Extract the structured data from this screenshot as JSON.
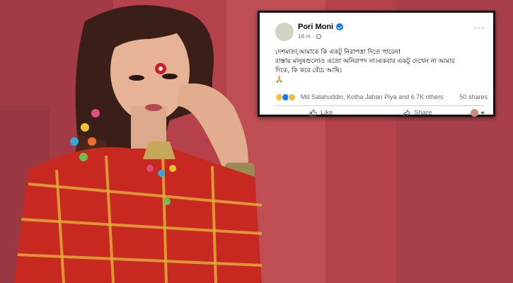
{
  "post": {
    "author": "Pori Moni",
    "time": "16 m",
    "time_separator": "·",
    "more_label": "···",
    "text_lines": [
      "দেশমাতা,আমাকে কি একটু নিরাপত্তা দিতে পারেন!",
      "রাস্তায় মানুষগুলোও এতো অনিরাপদ না।একবার একটু দেখেন না আমার",
      "দিকে, কি করে বেঁচে আছি।"
    ],
    "emoji": "🙏",
    "reactions_summary": "Md Salahuddin, Kotha Jahan Piya and 6.7K others",
    "shares": "50 shares",
    "like_label": "Like",
    "share_label": "Share"
  },
  "icons": {
    "verified": "verified-badge-icon",
    "audience": "globe-icon",
    "like": "thumbs-up-icon",
    "share": "share-arrow-icon",
    "reactions": [
      "haha-reaction-icon",
      "like-reaction-icon",
      "sad-reaction-icon"
    ]
  },
  "colors": {
    "facebook_blue": "#1877f2",
    "background_red": "#b8434a",
    "card_border": "#111111"
  }
}
